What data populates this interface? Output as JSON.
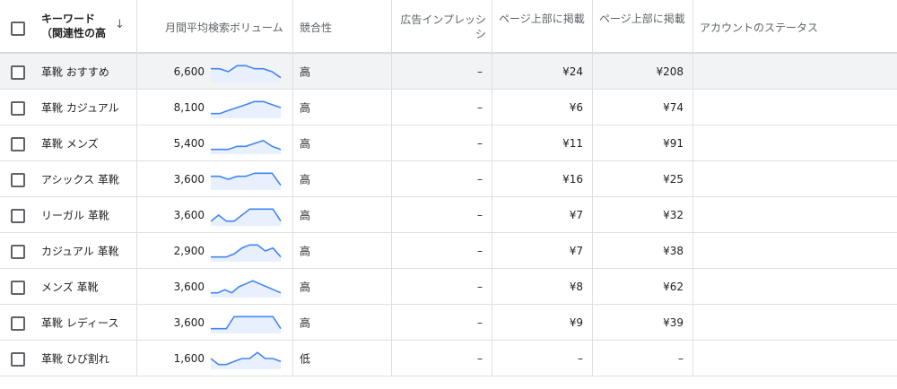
{
  "header": {
    "keyword_title": "キーワード",
    "keyword_subtitle": "（関連性の高",
    "sort_icon": "arrow-down-icon",
    "volume": "月間平均検索ボリューム",
    "competition": "競合性",
    "impression_line1": "広告インプレッシ",
    "impression_line2": "シ",
    "bid_low": "ページ上部に掲載",
    "bid_high": "ページ上部に掲載",
    "account_status": "アカウントのステータス"
  },
  "colors": {
    "sparkline_stroke": "#4285f4",
    "sparkline_fill": "#e8f0fe",
    "highlight_row": "#f1f3f4"
  },
  "rows": [
    {
      "keyword": "革靴 おすすめ",
      "volume": "6,600",
      "trend": [
        5,
        5,
        4,
        6,
        6,
        5,
        5,
        4,
        2
      ],
      "competition": "高",
      "impression": "–",
      "bid_low": "¥24",
      "bid_high": "¥208"
    },
    {
      "keyword": "革靴 カジュアル",
      "volume": "8,100",
      "trend": [
        2,
        2,
        3,
        4,
        5,
        6,
        6,
        5,
        4
      ],
      "competition": "高",
      "impression": "–",
      "bid_low": "¥6",
      "bid_high": "¥74"
    },
    {
      "keyword": "革靴 メンズ",
      "volume": "5,400",
      "trend": [
        2,
        2,
        2,
        3,
        3,
        4,
        5,
        3,
        2
      ],
      "competition": "高",
      "impression": "–",
      "bid_low": "¥11",
      "bid_high": "¥91"
    },
    {
      "keyword": "アシックス 革靴",
      "volume": "3,600",
      "trend": [
        5,
        5,
        4,
        5,
        5,
        6,
        6,
        6,
        2
      ],
      "competition": "高",
      "impression": "–",
      "bid_low": "¥16",
      "bid_high": "¥25"
    },
    {
      "keyword": "リーガル 革靴",
      "volume": "3,600",
      "trend": [
        2,
        4,
        2,
        2,
        4,
        6,
        6,
        6,
        6,
        2
      ],
      "competition": "高",
      "impression": "–",
      "bid_low": "¥7",
      "bid_high": "¥32"
    },
    {
      "keyword": "カジュアル 革靴",
      "volume": "2,900",
      "trend": [
        2,
        2,
        2,
        3,
        5,
        6,
        6,
        4,
        5,
        2
      ],
      "competition": "高",
      "impression": "–",
      "bid_low": "¥7",
      "bid_high": "¥38"
    },
    {
      "keyword": "メンズ 革靴",
      "volume": "3,600",
      "trend": [
        2,
        2,
        3,
        2,
        4,
        5,
        6,
        5,
        4,
        3,
        2
      ],
      "competition": "高",
      "impression": "–",
      "bid_low": "¥8",
      "bid_high": "¥62"
    },
    {
      "keyword": "革靴 レディース",
      "volume": "3,600",
      "trend": [
        2,
        2,
        2,
        6,
        6,
        6,
        6,
        6,
        6,
        2
      ],
      "competition": "高",
      "impression": "–",
      "bid_low": "¥9",
      "bid_high": "¥39"
    },
    {
      "keyword": "革靴 ひび割れ",
      "volume": "1,600",
      "trend": [
        4,
        2,
        2,
        3,
        4,
        4,
        6,
        4,
        4,
        3
      ],
      "competition": "低",
      "impression": "–",
      "bid_low": "–",
      "bid_high": "–"
    }
  ]
}
